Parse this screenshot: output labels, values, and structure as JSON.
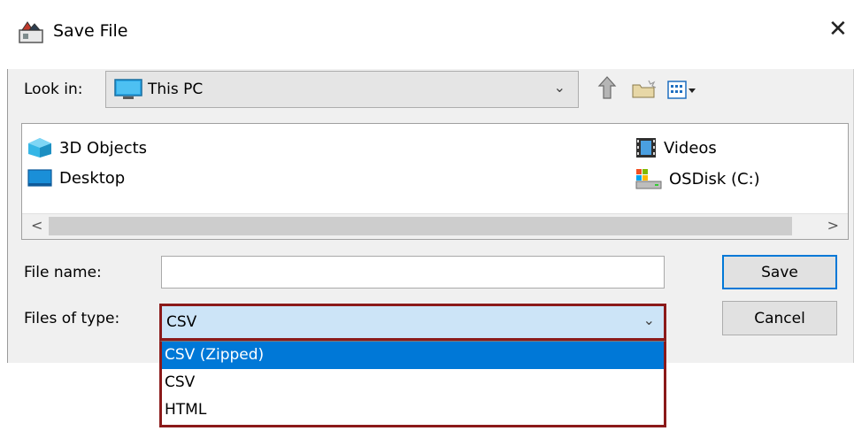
{
  "window": {
    "title": "Save File",
    "close_glyph": "✕"
  },
  "look_in": {
    "label": "Look in:",
    "value": "This PC",
    "icon": "monitor-icon",
    "toolbar": [
      "up-one-level-icon",
      "create-new-folder-icon",
      "view-menu-icon"
    ]
  },
  "file_list": {
    "items": [
      {
        "name": "3D Objects",
        "icon": "3d-objects-icon"
      },
      {
        "name": "Desktop",
        "icon": "desktop-icon"
      },
      {
        "name": "Videos",
        "icon": "videos-icon"
      },
      {
        "name": "OSDisk (C:)",
        "icon": "disk-drive-icon"
      }
    ],
    "scroll_left": "<",
    "scroll_right": ">"
  },
  "file_name": {
    "label": "File name:",
    "value": "",
    "placeholder": ""
  },
  "file_type": {
    "label": "Files of type:",
    "selected": "CSV",
    "options": [
      "CSV (Zipped)",
      "CSV",
      "HTML"
    ],
    "highlighted_option": "CSV (Zipped)"
  },
  "buttons": {
    "save": "Save",
    "cancel": "Cancel"
  },
  "colors": {
    "accent": "#0078d7",
    "dialog_bg": "#f0f0f0",
    "highlight_box": "#8b1a1a",
    "select_bg": "#cce4f7"
  }
}
